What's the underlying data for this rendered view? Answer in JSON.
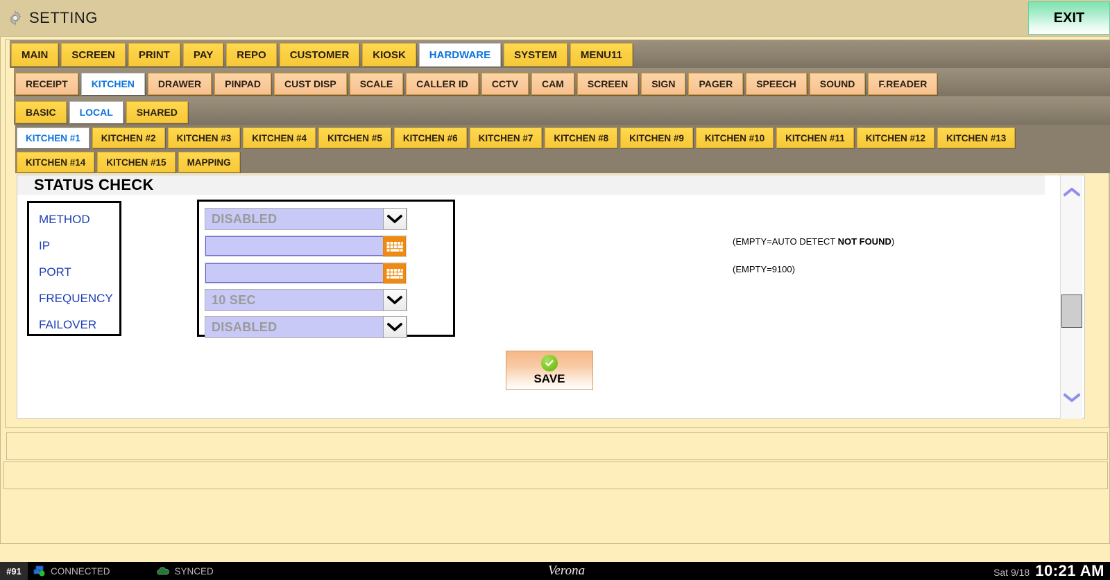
{
  "titlebar": {
    "icon": "gear-icon",
    "title": "SETTING",
    "exit_label": "EXIT"
  },
  "tabs_row1": [
    {
      "label": "MAIN",
      "active": false
    },
    {
      "label": "SCREEN",
      "active": false
    },
    {
      "label": "PRINT",
      "active": false
    },
    {
      "label": "PAY",
      "active": false
    },
    {
      "label": "REPO",
      "active": false
    },
    {
      "label": "CUSTOMER",
      "active": false
    },
    {
      "label": "KIOSK",
      "active": false
    },
    {
      "label": "HARDWARE",
      "active": true
    },
    {
      "label": "SYSTEM",
      "active": false
    },
    {
      "label": "MENU11",
      "active": false
    }
  ],
  "tabs_row2": [
    {
      "label": "RECEIPT",
      "active": false
    },
    {
      "label": "KITCHEN",
      "active": true
    },
    {
      "label": "DRAWER",
      "active": false
    },
    {
      "label": "PINPAD",
      "active": false
    },
    {
      "label": "CUST DISP",
      "active": false
    },
    {
      "label": "SCALE",
      "active": false
    },
    {
      "label": "CALLER ID",
      "active": false
    },
    {
      "label": "CCTV",
      "active": false
    },
    {
      "label": "CAM",
      "active": false
    },
    {
      "label": "SCREEN",
      "active": false
    },
    {
      "label": "SIGN",
      "active": false
    },
    {
      "label": "PAGER",
      "active": false
    },
    {
      "label": "SPEECH",
      "active": false
    },
    {
      "label": "SOUND",
      "active": false
    },
    {
      "label": "F.READER",
      "active": false
    }
  ],
  "tabs_row3": [
    {
      "label": "BASIC",
      "active": false
    },
    {
      "label": "LOCAL",
      "active": true
    },
    {
      "label": "SHARED",
      "active": false
    }
  ],
  "tabs_row4": [
    {
      "label": "KITCHEN #1",
      "active": true
    },
    {
      "label": "KITCHEN #2",
      "active": false
    },
    {
      "label": "KITCHEN #3",
      "active": false
    },
    {
      "label": "KITCHEN #4",
      "active": false
    },
    {
      "label": "KITCHEN #5",
      "active": false
    },
    {
      "label": "KITCHEN #6",
      "active": false
    },
    {
      "label": "KITCHEN #7",
      "active": false
    },
    {
      "label": "KITCHEN #8",
      "active": false
    },
    {
      "label": "KITCHEN #9",
      "active": false
    },
    {
      "label": "KITCHEN #10",
      "active": false
    },
    {
      "label": "KITCHEN #11",
      "active": false
    },
    {
      "label": "KITCHEN #12",
      "active": false
    },
    {
      "label": "KITCHEN #13",
      "active": false
    }
  ],
  "tabs_row5": [
    {
      "label": "KITCHEN #14",
      "active": false
    },
    {
      "label": "KITCHEN #15",
      "active": false
    },
    {
      "label": "MAPPING",
      "active": false
    }
  ],
  "section": {
    "title": "STATUS CHECK",
    "labels": [
      "METHOD",
      "IP",
      "PORT",
      "FREQUENCY",
      "FAILOVER"
    ],
    "controls": [
      {
        "kind": "select",
        "value": "DISABLED"
      },
      {
        "kind": "text",
        "value": "",
        "placeholder": ""
      },
      {
        "kind": "text",
        "value": "",
        "placeholder": ""
      },
      {
        "kind": "select",
        "value": "10 SEC"
      },
      {
        "kind": "select",
        "value": "DISABLED"
      }
    ],
    "hints": {
      "ip_hint_prefix": "(EMPTY=AUTO DETECT ",
      "ip_hint_bold": "NOT FOUND",
      "ip_hint_suffix": ")",
      "port_hint": "(EMPTY=9100)"
    },
    "save_label": "SAVE"
  },
  "statusbar": {
    "terminal": "#91",
    "connection": "CONNECTED",
    "sync": "SYNCED",
    "brand": "Verona",
    "date": "Sat 9/18",
    "time": "10:21 AM"
  },
  "colors": {
    "accent_blue": "#0a74de",
    "tab_yellow": "#fbcf42",
    "tab_peach": "#fac99a",
    "background": "#fdeebc",
    "titlebar": "#dbcb9c",
    "field_lavender": "#c9c9f7",
    "keyboard_orange": "#ef8b12",
    "label_blue": "#1e3fb5",
    "save_green": "#7ec720"
  }
}
